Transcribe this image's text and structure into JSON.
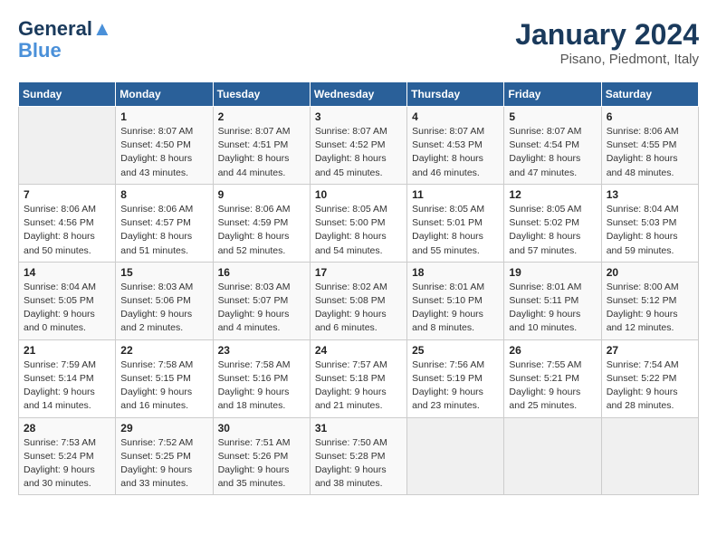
{
  "header": {
    "logo_line1": "General",
    "logo_line2": "Blue",
    "month_year": "January 2024",
    "location": "Pisano, Piedmont, Italy"
  },
  "days_of_week": [
    "Sunday",
    "Monday",
    "Tuesday",
    "Wednesday",
    "Thursday",
    "Friday",
    "Saturday"
  ],
  "weeks": [
    [
      {
        "num": "",
        "info": ""
      },
      {
        "num": "1",
        "info": "Sunrise: 8:07 AM\nSunset: 4:50 PM\nDaylight: 8 hours\nand 43 minutes."
      },
      {
        "num": "2",
        "info": "Sunrise: 8:07 AM\nSunset: 4:51 PM\nDaylight: 8 hours\nand 44 minutes."
      },
      {
        "num": "3",
        "info": "Sunrise: 8:07 AM\nSunset: 4:52 PM\nDaylight: 8 hours\nand 45 minutes."
      },
      {
        "num": "4",
        "info": "Sunrise: 8:07 AM\nSunset: 4:53 PM\nDaylight: 8 hours\nand 46 minutes."
      },
      {
        "num": "5",
        "info": "Sunrise: 8:07 AM\nSunset: 4:54 PM\nDaylight: 8 hours\nand 47 minutes."
      },
      {
        "num": "6",
        "info": "Sunrise: 8:06 AM\nSunset: 4:55 PM\nDaylight: 8 hours\nand 48 minutes."
      }
    ],
    [
      {
        "num": "7",
        "info": "Sunrise: 8:06 AM\nSunset: 4:56 PM\nDaylight: 8 hours\nand 50 minutes."
      },
      {
        "num": "8",
        "info": "Sunrise: 8:06 AM\nSunset: 4:57 PM\nDaylight: 8 hours\nand 51 minutes."
      },
      {
        "num": "9",
        "info": "Sunrise: 8:06 AM\nSunset: 4:59 PM\nDaylight: 8 hours\nand 52 minutes."
      },
      {
        "num": "10",
        "info": "Sunrise: 8:05 AM\nSunset: 5:00 PM\nDaylight: 8 hours\nand 54 minutes."
      },
      {
        "num": "11",
        "info": "Sunrise: 8:05 AM\nSunset: 5:01 PM\nDaylight: 8 hours\nand 55 minutes."
      },
      {
        "num": "12",
        "info": "Sunrise: 8:05 AM\nSunset: 5:02 PM\nDaylight: 8 hours\nand 57 minutes."
      },
      {
        "num": "13",
        "info": "Sunrise: 8:04 AM\nSunset: 5:03 PM\nDaylight: 8 hours\nand 59 minutes."
      }
    ],
    [
      {
        "num": "14",
        "info": "Sunrise: 8:04 AM\nSunset: 5:05 PM\nDaylight: 9 hours\nand 0 minutes."
      },
      {
        "num": "15",
        "info": "Sunrise: 8:03 AM\nSunset: 5:06 PM\nDaylight: 9 hours\nand 2 minutes."
      },
      {
        "num": "16",
        "info": "Sunrise: 8:03 AM\nSunset: 5:07 PM\nDaylight: 9 hours\nand 4 minutes."
      },
      {
        "num": "17",
        "info": "Sunrise: 8:02 AM\nSunset: 5:08 PM\nDaylight: 9 hours\nand 6 minutes."
      },
      {
        "num": "18",
        "info": "Sunrise: 8:01 AM\nSunset: 5:10 PM\nDaylight: 9 hours\nand 8 minutes."
      },
      {
        "num": "19",
        "info": "Sunrise: 8:01 AM\nSunset: 5:11 PM\nDaylight: 9 hours\nand 10 minutes."
      },
      {
        "num": "20",
        "info": "Sunrise: 8:00 AM\nSunset: 5:12 PM\nDaylight: 9 hours\nand 12 minutes."
      }
    ],
    [
      {
        "num": "21",
        "info": "Sunrise: 7:59 AM\nSunset: 5:14 PM\nDaylight: 9 hours\nand 14 minutes."
      },
      {
        "num": "22",
        "info": "Sunrise: 7:58 AM\nSunset: 5:15 PM\nDaylight: 9 hours\nand 16 minutes."
      },
      {
        "num": "23",
        "info": "Sunrise: 7:58 AM\nSunset: 5:16 PM\nDaylight: 9 hours\nand 18 minutes."
      },
      {
        "num": "24",
        "info": "Sunrise: 7:57 AM\nSunset: 5:18 PM\nDaylight: 9 hours\nand 21 minutes."
      },
      {
        "num": "25",
        "info": "Sunrise: 7:56 AM\nSunset: 5:19 PM\nDaylight: 9 hours\nand 23 minutes."
      },
      {
        "num": "26",
        "info": "Sunrise: 7:55 AM\nSunset: 5:21 PM\nDaylight: 9 hours\nand 25 minutes."
      },
      {
        "num": "27",
        "info": "Sunrise: 7:54 AM\nSunset: 5:22 PM\nDaylight: 9 hours\nand 28 minutes."
      }
    ],
    [
      {
        "num": "28",
        "info": "Sunrise: 7:53 AM\nSunset: 5:24 PM\nDaylight: 9 hours\nand 30 minutes."
      },
      {
        "num": "29",
        "info": "Sunrise: 7:52 AM\nSunset: 5:25 PM\nDaylight: 9 hours\nand 33 minutes."
      },
      {
        "num": "30",
        "info": "Sunrise: 7:51 AM\nSunset: 5:26 PM\nDaylight: 9 hours\nand 35 minutes."
      },
      {
        "num": "31",
        "info": "Sunrise: 7:50 AM\nSunset: 5:28 PM\nDaylight: 9 hours\nand 38 minutes."
      },
      {
        "num": "",
        "info": ""
      },
      {
        "num": "",
        "info": ""
      },
      {
        "num": "",
        "info": ""
      }
    ]
  ]
}
